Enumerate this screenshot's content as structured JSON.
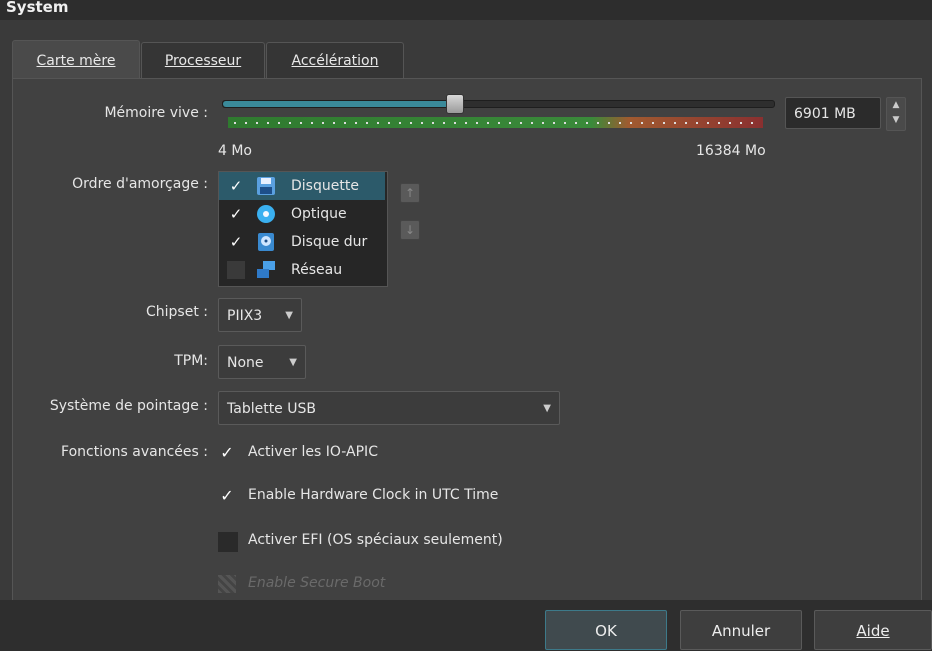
{
  "section_title": "System",
  "tabs": [
    {
      "label": "Carte mère",
      "active": true
    },
    {
      "label": "Processeur",
      "active": false
    },
    {
      "label": "Accélération",
      "active": false
    }
  ],
  "memory": {
    "label": "Mémoire vive :",
    "value": "6901 MB",
    "min_label": "4 Mo",
    "max_label": "16384 Mo",
    "slider_fraction": 0.42
  },
  "boot_order": {
    "label": "Ordre d'amorçage :",
    "items": [
      {
        "label": "Disquette",
        "checked": true,
        "icon": "floppy-icon",
        "selected": true
      },
      {
        "label": "Optique",
        "checked": true,
        "icon": "optical-disc-icon",
        "selected": false
      },
      {
        "label": "Disque dur",
        "checked": true,
        "icon": "hard-disk-icon",
        "selected": false
      },
      {
        "label": "Réseau",
        "checked": false,
        "icon": "network-icon",
        "selected": false
      }
    ]
  },
  "chipset": {
    "label": "Chipset :",
    "value": "PIIX3"
  },
  "tpm": {
    "label": "TPM:",
    "value": "None"
  },
  "pointing": {
    "label": "Système de pointage :",
    "value": "Tablette USB"
  },
  "advanced": {
    "label": "Fonctions avancées :",
    "options": [
      {
        "label": "Activer les IO-APIC",
        "checked": true,
        "enabled": true
      },
      {
        "label": "Enable Hardware Clock in UTC Time",
        "checked": true,
        "enabled": true
      },
      {
        "label": "Activer EFI (OS spéciaux seulement)",
        "checked": false,
        "enabled": true
      },
      {
        "label": "Enable Secure Boot",
        "checked": false,
        "enabled": false
      }
    ]
  },
  "buttons": {
    "ok": "OK",
    "cancel": "Annuler",
    "help": "Aide"
  },
  "colors": {
    "accent": "#3a8a9a",
    "selection": "#2c5a6a",
    "background": "#3a3a3a"
  }
}
